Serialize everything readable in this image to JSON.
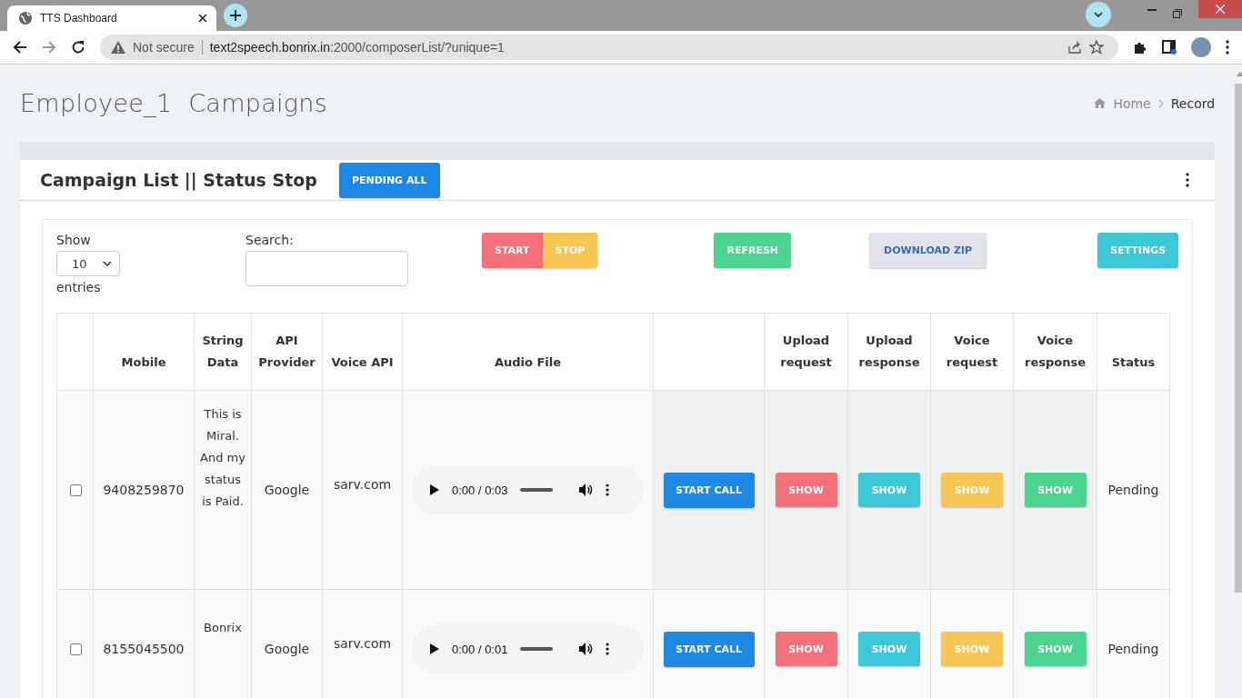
{
  "browser": {
    "tabs": [
      {
        "title": "TTS Dashboard",
        "selected": true
      }
    ],
    "security": "Not secure",
    "url_host": "text2speech.bonrix.in",
    "url_rest": ":2000/composerList/?unique=1"
  },
  "page": {
    "title": "Employee_1  Campaigns",
    "breadcrumb": [
      "Home",
      "Record"
    ]
  },
  "card": {
    "title": "Campaign List || Status Stop",
    "header_button": "PENDING ALL"
  },
  "controls": {
    "show_label": "Show",
    "page_size": "10",
    "entries_label": "entries",
    "search_label": "Search:",
    "buttons": [
      {
        "label": "START",
        "kind": "start"
      },
      {
        "label": "STOP",
        "kind": "stop"
      },
      {
        "label": "REFRESH",
        "kind": "refresh"
      },
      {
        "label": "DOWNLOAD ZIP",
        "kind": "download"
      },
      {
        "label": "SETTINGS",
        "kind": "settings"
      }
    ]
  },
  "table": {
    "columns": [
      "",
      "Mobile",
      "String Data",
      "API Provider",
      "Voice API",
      "Audio File",
      "",
      "Upload request",
      "Upload response",
      "Voice request",
      "Voice response",
      "Status"
    ],
    "rows": [
      {
        "checked": false,
        "highlighted": true,
        "mobile": "9408259870",
        "string_data": "This is Miral. And my status is Paid.",
        "api_provider": "Google",
        "voice_api": "sarv.com",
        "audio_time": "0:00 / 0:03",
        "call_button": "START CALL",
        "actions": [
          "SHOW",
          "SHOW",
          "SHOW",
          "SHOW"
        ],
        "status": "Pending"
      },
      {
        "checked": false,
        "highlighted": false,
        "mobile": "8155045500",
        "string_data": "Bonrix",
        "api_provider": "Google",
        "voice_api": "sarv.com",
        "audio_time": "0:00 / 0:01",
        "call_button": "START CALL",
        "actions": [
          "SHOW",
          "SHOW",
          "SHOW",
          "SHOW"
        ],
        "status": "Pending"
      }
    ]
  }
}
